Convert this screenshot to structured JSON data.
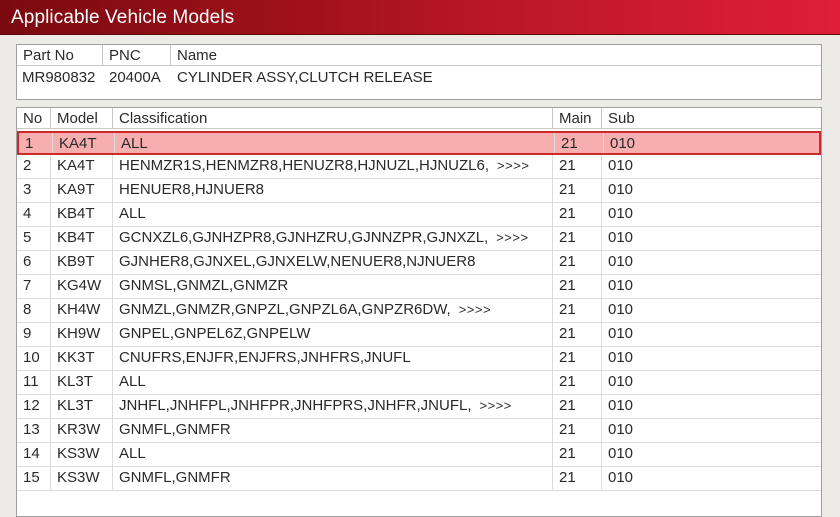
{
  "window": {
    "title": "Applicable Vehicle Models"
  },
  "part": {
    "headers": {
      "part_no": "Part No",
      "pnc": "PNC",
      "name": "Name"
    },
    "values": {
      "part_no": "MR980832",
      "pnc": "20400A",
      "name": "CYLINDER ASSY,CLUTCH RELEASE"
    }
  },
  "models": {
    "headers": {
      "no": "No",
      "model": "Model",
      "classification": "Classification",
      "main": "Main",
      "sub": "Sub"
    },
    "selected_index": 0,
    "rows": [
      {
        "no": "1",
        "model": "KA4T",
        "classification": "ALL",
        "more": "",
        "main": "21",
        "sub": "010"
      },
      {
        "no": "2",
        "model": "KA4T",
        "classification": "HENMZR1S,HENMZR8,HENUZR8,HJNUZL,HJNUZL6,",
        "more": ">>>>",
        "main": "21",
        "sub": "010"
      },
      {
        "no": "3",
        "model": "KA9T",
        "classification": "HENUER8,HJNUER8",
        "more": "",
        "main": "21",
        "sub": "010"
      },
      {
        "no": "4",
        "model": "KB4T",
        "classification": "ALL",
        "more": "",
        "main": "21",
        "sub": "010"
      },
      {
        "no": "5",
        "model": "KB4T",
        "classification": "GCNXZL6,GJNHZPR8,GJNHZRU,GJNNZPR,GJNXZL,",
        "more": ">>>>",
        "main": "21",
        "sub": "010"
      },
      {
        "no": "6",
        "model": "KB9T",
        "classification": "GJNHER8,GJNXEL,GJNXELW,NENUER8,NJNUER8",
        "more": "",
        "main": "21",
        "sub": "010"
      },
      {
        "no": "7",
        "model": "KG4W",
        "classification": "GNMSL,GNMZL,GNMZR",
        "more": "",
        "main": "21",
        "sub": "010"
      },
      {
        "no": "8",
        "model": "KH4W",
        "classification": "GNMZL,GNMZR,GNPZL,GNPZL6A,GNPZR6DW,",
        "more": ">>>>",
        "main": "21",
        "sub": "010"
      },
      {
        "no": "9",
        "model": "KH9W",
        "classification": "GNPEL,GNPEL6Z,GNPELW",
        "more": "",
        "main": "21",
        "sub": "010"
      },
      {
        "no": "10",
        "model": "KK3T",
        "classification": "CNUFRS,ENJFR,ENJFRS,JNHFRS,JNUFL",
        "more": "",
        "main": "21",
        "sub": "010"
      },
      {
        "no": "11",
        "model": "KL3T",
        "classification": "ALL",
        "more": "",
        "main": "21",
        "sub": "010"
      },
      {
        "no": "12",
        "model": "KL3T",
        "classification": "JNHFL,JNHFPL,JNHFPR,JNHFPRS,JNHFR,JNUFL,",
        "more": ">>>>",
        "main": "21",
        "sub": "010"
      },
      {
        "no": "13",
        "model": "KR3W",
        "classification": "GNMFL,GNMFR",
        "more": "",
        "main": "21",
        "sub": "010"
      },
      {
        "no": "14",
        "model": "KS3W",
        "classification": "ALL",
        "more": "",
        "main": "21",
        "sub": "010"
      },
      {
        "no": "15",
        "model": "KS3W",
        "classification": "GNMFL,GNMFR",
        "more": "",
        "main": "21",
        "sub": "010"
      }
    ]
  }
}
